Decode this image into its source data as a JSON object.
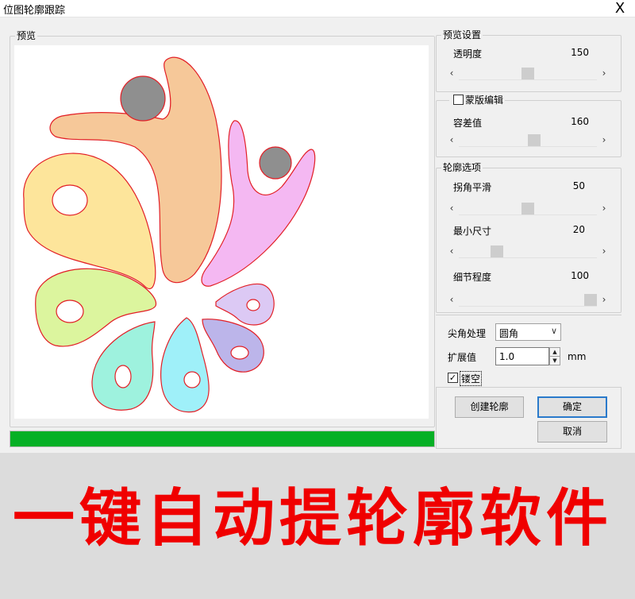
{
  "window": {
    "title": "位图轮廓跟踪",
    "close_label": "X"
  },
  "preview": {
    "legend": "预览",
    "progress_percent": 100,
    "colors": {
      "fill_orange": "#f6c899",
      "fill_pink": "#f4b8f2",
      "fill_yellow": "#fde59b",
      "fill_lime": "#dcf59e",
      "fill_mint": "#9ef2de",
      "fill_cyan": "#9ff0f9",
      "fill_lavender": "#bcb5ea",
      "fill_light_purple": "#dcc9f4",
      "fill_gray_circle": "#8f8f8f",
      "outline": "#e21f26",
      "progress": "#06b025"
    }
  },
  "preview_settings": {
    "legend": "预览设置",
    "opacity": {
      "label": "透明度",
      "value": "150",
      "position": 0.5
    }
  },
  "mask_edit": {
    "checkbox_label": "蒙版编辑",
    "checked": false,
    "tolerance": {
      "label": "容差值",
      "value": "160",
      "position": 0.55
    }
  },
  "contour_options": {
    "legend": "轮廓选项",
    "corner_smooth": {
      "label": "拐角平滑",
      "value": "50",
      "position": 0.5
    },
    "min_size": {
      "label": "最小尺寸",
      "value": "20",
      "position": 0.25
    },
    "detail_level": {
      "label": "细节程度",
      "value": "100",
      "position": 1.0
    }
  },
  "corner": {
    "label": "尖角处理",
    "selected": "圆角"
  },
  "expand": {
    "label": "扩展值",
    "value": "1.0",
    "unit": "mm"
  },
  "hollow": {
    "label": "镂空",
    "checked": true
  },
  "buttons": {
    "create": "创建轮廓",
    "ok": "确定",
    "cancel": "取消"
  },
  "banner": {
    "text": "一键自动提轮廓软件"
  }
}
